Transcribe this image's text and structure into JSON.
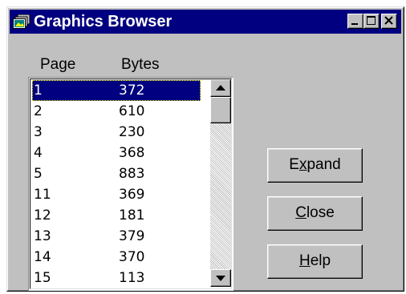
{
  "window": {
    "title": "Graphics Browser",
    "icon": "graphics-browser-app-icon",
    "controls": {
      "minimize_icon": "minimize-icon",
      "maximize_icon": "maximize-icon",
      "close_icon": "close-icon"
    }
  },
  "list": {
    "headers": {
      "page": "Page",
      "bytes": "Bytes"
    },
    "rows": [
      {
        "page": "1",
        "bytes": "372",
        "selected": true
      },
      {
        "page": "2",
        "bytes": "610"
      },
      {
        "page": "3",
        "bytes": "230"
      },
      {
        "page": "4",
        "bytes": "368"
      },
      {
        "page": "5",
        "bytes": "883"
      },
      {
        "page": "11",
        "bytes": "369"
      },
      {
        "page": "12",
        "bytes": "181"
      },
      {
        "page": "13",
        "bytes": "379"
      },
      {
        "page": "14",
        "bytes": "370"
      },
      {
        "page": "15",
        "bytes": "113"
      }
    ],
    "scrollbar": {
      "up_icon": "scroll-up-arrow-icon",
      "down_icon": "scroll-down-arrow-icon"
    }
  },
  "buttons": {
    "expand": {
      "before": "E",
      "mnemonic": "x",
      "after": "pand"
    },
    "close": {
      "before": "",
      "mnemonic": "C",
      "after": "lose"
    },
    "help": {
      "before": "",
      "mnemonic": "H",
      "after": "elp"
    }
  },
  "colors": {
    "titlebar": "#000080",
    "face": "#c0c0c0",
    "selection": "#000080"
  }
}
